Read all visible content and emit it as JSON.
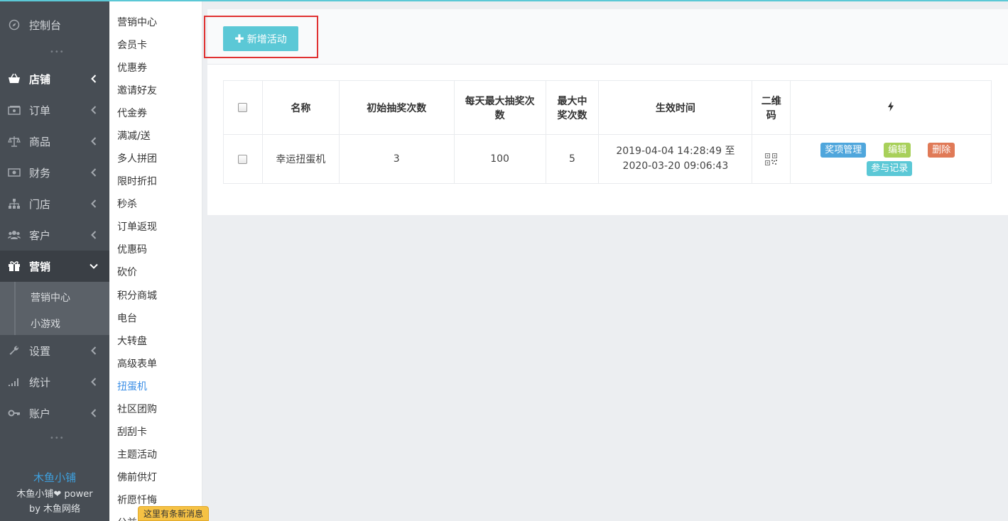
{
  "sidebar": {
    "items": [
      {
        "label": "控制台",
        "icon": "compass-icon"
      },
      {
        "label": "店铺",
        "icon": "basket-icon"
      },
      {
        "label": "订单",
        "icon": "money-icon"
      },
      {
        "label": "商品",
        "icon": "scale-icon"
      },
      {
        "label": "财务",
        "icon": "cash-icon"
      },
      {
        "label": "门店",
        "icon": "sitemap-icon"
      },
      {
        "label": "客户",
        "icon": "users-icon"
      },
      {
        "label": "营销",
        "icon": "gift-icon"
      },
      {
        "label": "设置",
        "icon": "wrench-icon"
      },
      {
        "label": "统计",
        "icon": "signal-icon"
      },
      {
        "label": "账户",
        "icon": "key-icon"
      }
    ],
    "sub_items": [
      "营销中心",
      "小游戏"
    ],
    "brand": {
      "name": "木鱼小铺",
      "power": "木鱼小铺❤ power",
      "by_prefix": "by ",
      "by_name": "木鱼网络"
    }
  },
  "submenu": {
    "items": [
      "营销中心",
      "会员卡",
      "优惠券",
      "邀请好友",
      "代金券",
      "满减/送",
      "多人拼团",
      "限时折扣",
      "秒杀",
      "订单返现",
      "优惠码",
      "砍价",
      "积分商城",
      "电台",
      "大转盘",
      "高级表单",
      "扭蛋机",
      "社区团购",
      "刮刮卡",
      "主题活动",
      "佛前供灯",
      "祈愿忏悔",
      "公益"
    ],
    "current": "扭蛋机"
  },
  "toast": "这里有条新消息",
  "toolbar": {
    "add_label": "新增活动"
  },
  "table": {
    "headers": {
      "name": "名称",
      "initial": "初始抽奖次数",
      "daily_max_1": "每天最大抽奖次",
      "daily_max_2": "数",
      "max_win_1": "最大中",
      "max_win_2": "奖次数",
      "time": "生效时间",
      "qr_1": "二维",
      "qr_2": "码",
      "ops_icon": "bolt-icon"
    },
    "rows": [
      {
        "name": "幸运扭蛋机",
        "initial": "3",
        "daily_max": "100",
        "max_win": "5",
        "time_1": "2019-04-04 14:28:49 至",
        "time_2": "2020-03-20 09:06:43",
        "actions": {
          "prize": "奖项管理",
          "edit": "编辑",
          "delete": "删除",
          "records": "参与记录"
        }
      }
    ]
  },
  "colors": {
    "accent": "#5bc8d6",
    "link": "#3a8ee6",
    "sidebar_bg": "#474d54",
    "danger": "#e07a57",
    "success": "#a8d05a",
    "info": "#4fa6dc"
  }
}
